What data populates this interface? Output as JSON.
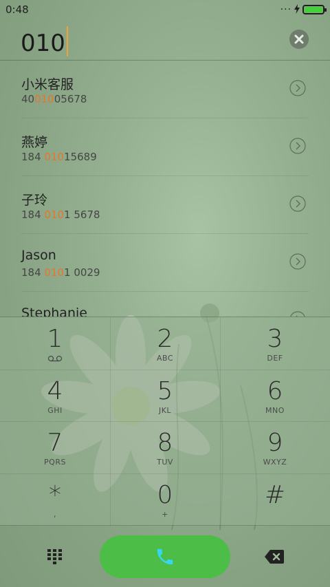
{
  "status_bar": {
    "time": "0:48",
    "dots": "...",
    "battery_icon": "battery-full-icon",
    "charging_icon": "bolt-icon",
    "battery_color": "#43d13a"
  },
  "dial_input": {
    "value": "010",
    "clear_icon": "close-circle-icon"
  },
  "contacts": [
    {
      "name": "小米客服",
      "phone_pre": "40",
      "phone_match": "010",
      "phone_post": "05678"
    },
    {
      "name": "燕婷",
      "phone_pre": "184 ",
      "phone_match": "010",
      "phone_post": "15689"
    },
    {
      "name": "子玲",
      "phone_pre": "184 ",
      "phone_match": "010",
      "phone_post": "1 5678"
    },
    {
      "name": "Jason",
      "phone_pre": "184 ",
      "phone_match": "010",
      "phone_post": "1 0029"
    },
    {
      "name": "Stephanie",
      "phone_pre": "",
      "phone_match": "",
      "phone_post": ""
    }
  ],
  "keypad": [
    {
      "digit": "1",
      "letters": "",
      "sub_icon": "voicemail-icon"
    },
    {
      "digit": "2",
      "letters": "ABC"
    },
    {
      "digit": "3",
      "letters": "DEF"
    },
    {
      "digit": "4",
      "letters": "GHI"
    },
    {
      "digit": "5",
      "letters": "JKL"
    },
    {
      "digit": "6",
      "letters": "MNO"
    },
    {
      "digit": "7",
      "letters": "PQRS"
    },
    {
      "digit": "8",
      "letters": "TUV"
    },
    {
      "digit": "9",
      "letters": "WXYZ"
    },
    {
      "digit": "*",
      "letters": ","
    },
    {
      "digit": "0",
      "letters": "+"
    },
    {
      "digit": "#",
      "letters": ""
    }
  ],
  "bottom_bar": {
    "keypad_icon": "dialpad-grid-icon",
    "call_icon": "phone-icon",
    "delete_icon": "backspace-icon",
    "call_color": "#4cbd47",
    "call_icon_color": "#36d6f0"
  },
  "colors": {
    "match_highlight": "#e8752a",
    "cursor": "#f3a23a"
  }
}
